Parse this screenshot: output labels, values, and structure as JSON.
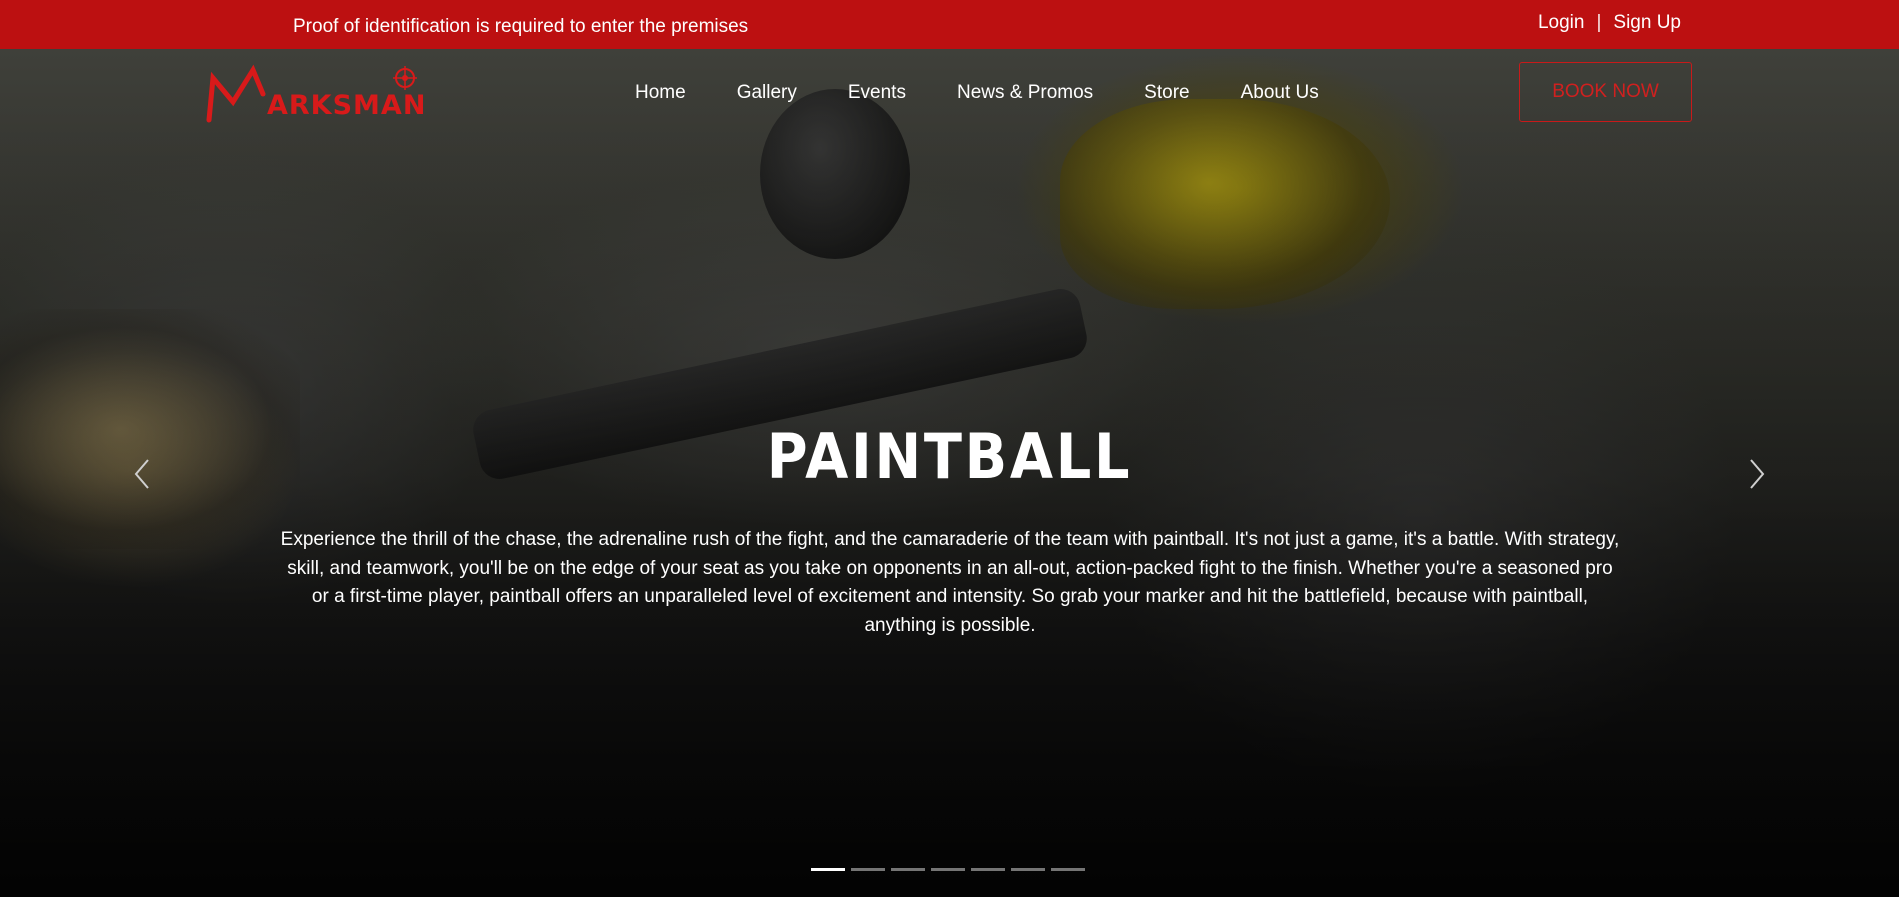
{
  "topbar": {
    "notice": "Proof of identification is required to enter the premises",
    "login": "Login",
    "separator": "|",
    "signup": "Sign Up"
  },
  "header": {
    "logo_text": "ARKSMAN",
    "nav": [
      "Home",
      "Gallery",
      "Events",
      "News & Promos",
      "Store",
      "About Us"
    ],
    "cta": "BOOK NOW"
  },
  "slide": {
    "title": "PAINTBALL",
    "description": "Experience the thrill of the chase, the adrenaline rush of the fight, and the camaraderie of the team with paintball. It's not just a game, it's a battle. With strategy, skill, and teamwork, you'll be on the edge of your seat as you take on opponents in an all-out, action-packed fight to the finish. Whether you're a seasoned pro or a first-time player, paintball offers an unparalleled level of excitement and intensity. So grab your marker and hit the battlefield, because with paintball, anything is possible.",
    "total_slides": 7,
    "active_slide": 1
  },
  "icons": {
    "prev": "chevron-left-icon",
    "next": "chevron-right-icon",
    "logo": "crosshair-logo-icon"
  },
  "colors": {
    "brand_red": "#bc1011",
    "accent_red": "#d81a1a",
    "text": "#ffffff"
  }
}
